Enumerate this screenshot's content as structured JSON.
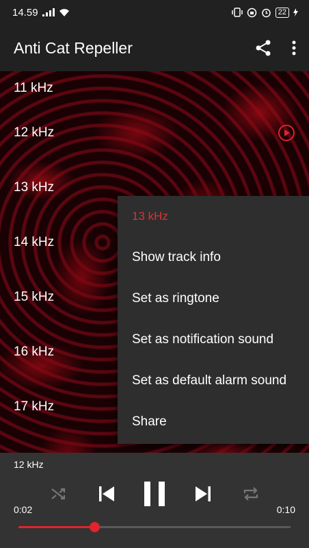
{
  "status": {
    "time": "14.59",
    "battery": "22"
  },
  "app_bar": {
    "title": "Anti Cat Repeller",
    "share_icon": "share-icon",
    "more_icon": "more-vert-icon"
  },
  "tracks": [
    {
      "label": "11 kHz"
    },
    {
      "label": "12 kHz",
      "playing": true
    },
    {
      "label": "13 kHz"
    },
    {
      "label": "14 kHz"
    },
    {
      "label": "15 kHz"
    },
    {
      "label": "16 kHz"
    },
    {
      "label": "17 kHz"
    }
  ],
  "context_menu": {
    "header": "13 kHz",
    "items": [
      "Show track info",
      "Set as ringtone",
      "Set as notification sound",
      "Set as default alarm sound",
      "Share"
    ]
  },
  "player": {
    "track": "12 kHz",
    "current_time": "0:02",
    "total_time": "0:10",
    "progress": 0.28,
    "state": "playing"
  },
  "colors": {
    "accent": "#e0232d",
    "bar": "#212121",
    "menu": "#2e2e2e",
    "player": "#333333"
  }
}
